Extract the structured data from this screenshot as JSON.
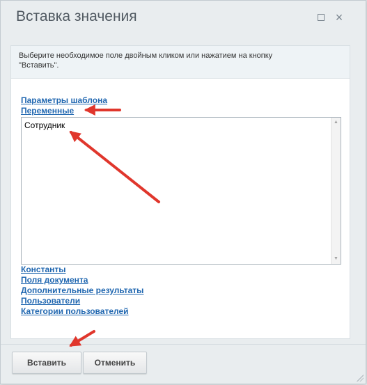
{
  "dialog": {
    "title": "Вставка значения",
    "close_glyph": "×"
  },
  "hint": {
    "line1": "Выберите необходимое поле двойным кликом или нажатием на кнопку",
    "line2": "\"Вставить\"."
  },
  "groups_top": [
    "Параметры шаблона",
    "Переменные"
  ],
  "list": {
    "options": [
      "Сотрудник"
    ]
  },
  "groups_bottom": [
    "Константы",
    "Поля документа",
    "Дополнительные результаты",
    "Пользователи",
    "Категории пользователей"
  ],
  "buttons": {
    "insert": "Вставить",
    "cancel": "Отменить"
  },
  "colors": {
    "link": "#2067b0",
    "annotation_arrow": "#e0362c"
  },
  "icons": {
    "maximize": "maximize-icon",
    "close": "close-icon",
    "scroll_up": "triangle-up-icon",
    "scroll_down": "triangle-down-icon",
    "annotation": "red-arrow"
  }
}
